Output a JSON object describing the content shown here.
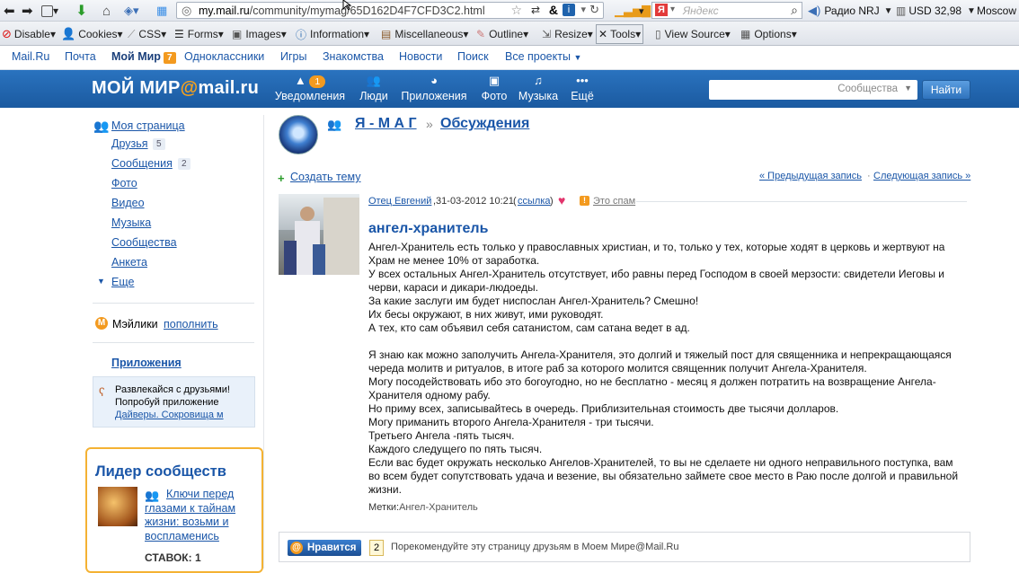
{
  "browser": {
    "url_host": "my.mail.ru",
    "url_path": "/community/mymag/65D162D4F7CFD3C2.html",
    "search_placeholder": "Яндекс",
    "radio": "Радио NRJ",
    "currency": "USD 32,98",
    "city": "Moscow",
    "toolbar": [
      "Disable",
      "Cookies",
      "CSS",
      "Forms",
      "Images",
      "Information",
      "Miscellaneous",
      "Outline",
      "Resize",
      "Tools",
      "View Source",
      "Options"
    ]
  },
  "topnav": {
    "items": [
      "Mail.Ru",
      "Почта",
      "Мой Мир",
      "Одноклассники",
      "Игры",
      "Знакомства",
      "Новости",
      "Поиск",
      "Все проекты"
    ],
    "moimir_badge": "7"
  },
  "header": {
    "logo_a": "МОЙ МИР",
    "logo_b": "@",
    "logo_c": "mail.ru",
    "nav": [
      "Уведомления",
      "Люди",
      "Приложения",
      "Фото",
      "Музыка",
      "Ещё"
    ],
    "notif_count": "1",
    "search_placeholder": "Сообщества",
    "find_button": "Найти"
  },
  "leftmenu": {
    "items": [
      "Моя страница",
      "Друзья",
      "Сообщения",
      "Фото",
      "Видео",
      "Музыка",
      "Сообщества",
      "Анкета",
      "Еще"
    ],
    "friends_count": "5",
    "messages_count": "2",
    "mailiki": "Мэйлики",
    "refill": "пополнить",
    "apps": "Приложения",
    "app_line1": "Развлекайся с друзьями!",
    "app_line2": "Попробуй приложение",
    "app_link": "Дайверы. Сокровища м",
    "leader_title": "Лидер сообществ",
    "leader_link": "Ключи перед глазами к тайнам жизни: возьми и воспламенись",
    "bids": "СТАВОК: 1"
  },
  "main": {
    "community": "Я - М А Г",
    "sep": "»",
    "section": "Обсуждения",
    "create_topic": "Создать тему",
    "prev": "« Предыдущая запись",
    "dot": "·",
    "next": "Следующая запись »",
    "author": "Отец Евгений",
    "date": ",31-03-2012 10:21",
    "link": "ссылка",
    "spam": "Это спам",
    "title": "ангел-хранитель",
    "paragraphs": [
      "Ангел-Хранитель есть только у православных христиан, и то, только у тех, которые ходят в церковь и жертвуют на Храм не менее 10% от заработка.",
      "У всех остальных Ангел-Хранитель отсутствует, ибо равны перед Господом в своей мерзости: свидетели Иеговы и черви, караси и дикари-людоеды.",
      "За какие заслуги им будет ниспослан Ангел-Хранитель? Смешно!",
      "Их бесы окружают, в них живут, ими руководят.",
      "А тех, кто сам объявил себя сатанистом, сам сатана ведет в ад.",
      "",
      "Я знаю как можно заполучить Ангела-Хранителя, это долгий и тяжелый пост для священника и непрекращающаяся череда молитв и ритуалов, в итоге раб за которого молится священник получит Ангела-Хранителя.",
      "Могу посодействовать ибо это богоугодно, но не бесплатно - месяц я должен потратить на возвращение Ангела-Хранителя одному рабу.",
      "Но приму всех, записывайтесь в очередь. Приблизительная стоимость две тысячи долларов.",
      "Могу приманить второго Ангела-Хранителя - три тысячи.",
      "Третьего Ангела -пять тысяч.",
      "Каждого следущего по пять тысяч.",
      "Если вас будет окружать несколько Ангелов-Хранителей, то вы не сделаете ни одного неправильного поступка, вам во всем будет сопутствовать удача и везение, вы обязательно займете свое место в Раю после долгой и правильной жизни."
    ],
    "tags_label": "Метки:",
    "tags": "Ангел-Хранитель",
    "like_button": "Нравится",
    "like_count": "2",
    "recommend": "Порекомендуйте эту страницу друзьям в Моем Мире@Mail.Ru"
  },
  "colors": {
    "header_blue": "#1f63ad",
    "link": "#1a56a8",
    "accent_orange": "#f39a1f"
  }
}
